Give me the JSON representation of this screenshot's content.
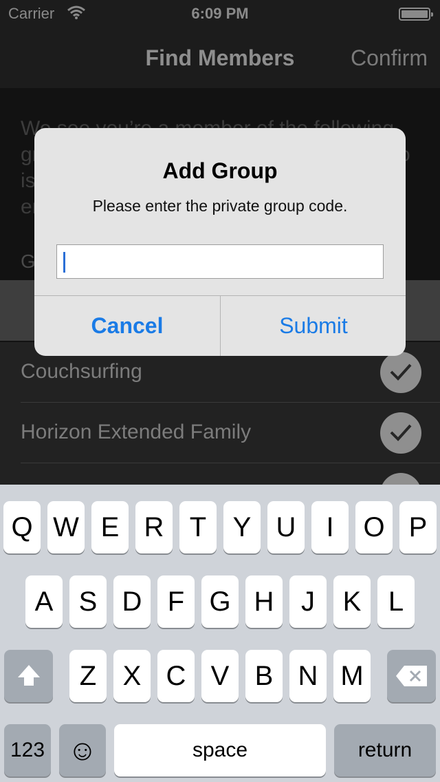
{
  "status": {
    "carrier": "Carrier",
    "time": "6:09 PM"
  },
  "nav": {
    "title": "Find Members",
    "confirm": "Confirm"
  },
  "intro": {
    "line1": "We see you’re a member of the following",
    "line2": "gr",
    "line2_end": "o",
    "line3": "is",
    "line4": "er"
  },
  "section_header": "G",
  "list": [
    "Couchsurfing",
    "Horizon Extended Family"
  ],
  "alert": {
    "title": "Add Group",
    "message": "Please enter the private group code.",
    "input_value": "",
    "cancel": "Cancel",
    "submit": "Submit"
  },
  "keyboard": {
    "row1": [
      "Q",
      "W",
      "E",
      "R",
      "T",
      "Y",
      "U",
      "I",
      "O",
      "P"
    ],
    "row2": [
      "A",
      "S",
      "D",
      "F",
      "G",
      "H",
      "J",
      "K",
      "L"
    ],
    "row3": [
      "Z",
      "X",
      "C",
      "V",
      "B",
      "N",
      "M"
    ],
    "numbers": "123",
    "emoji": "☺",
    "space": "space",
    "return": "return"
  },
  "icons": {
    "shift": "shift-icon",
    "backspace": "backspace-icon",
    "wifi": "wifi-icon",
    "battery": "battery-icon",
    "check": "checkmark-icon"
  }
}
